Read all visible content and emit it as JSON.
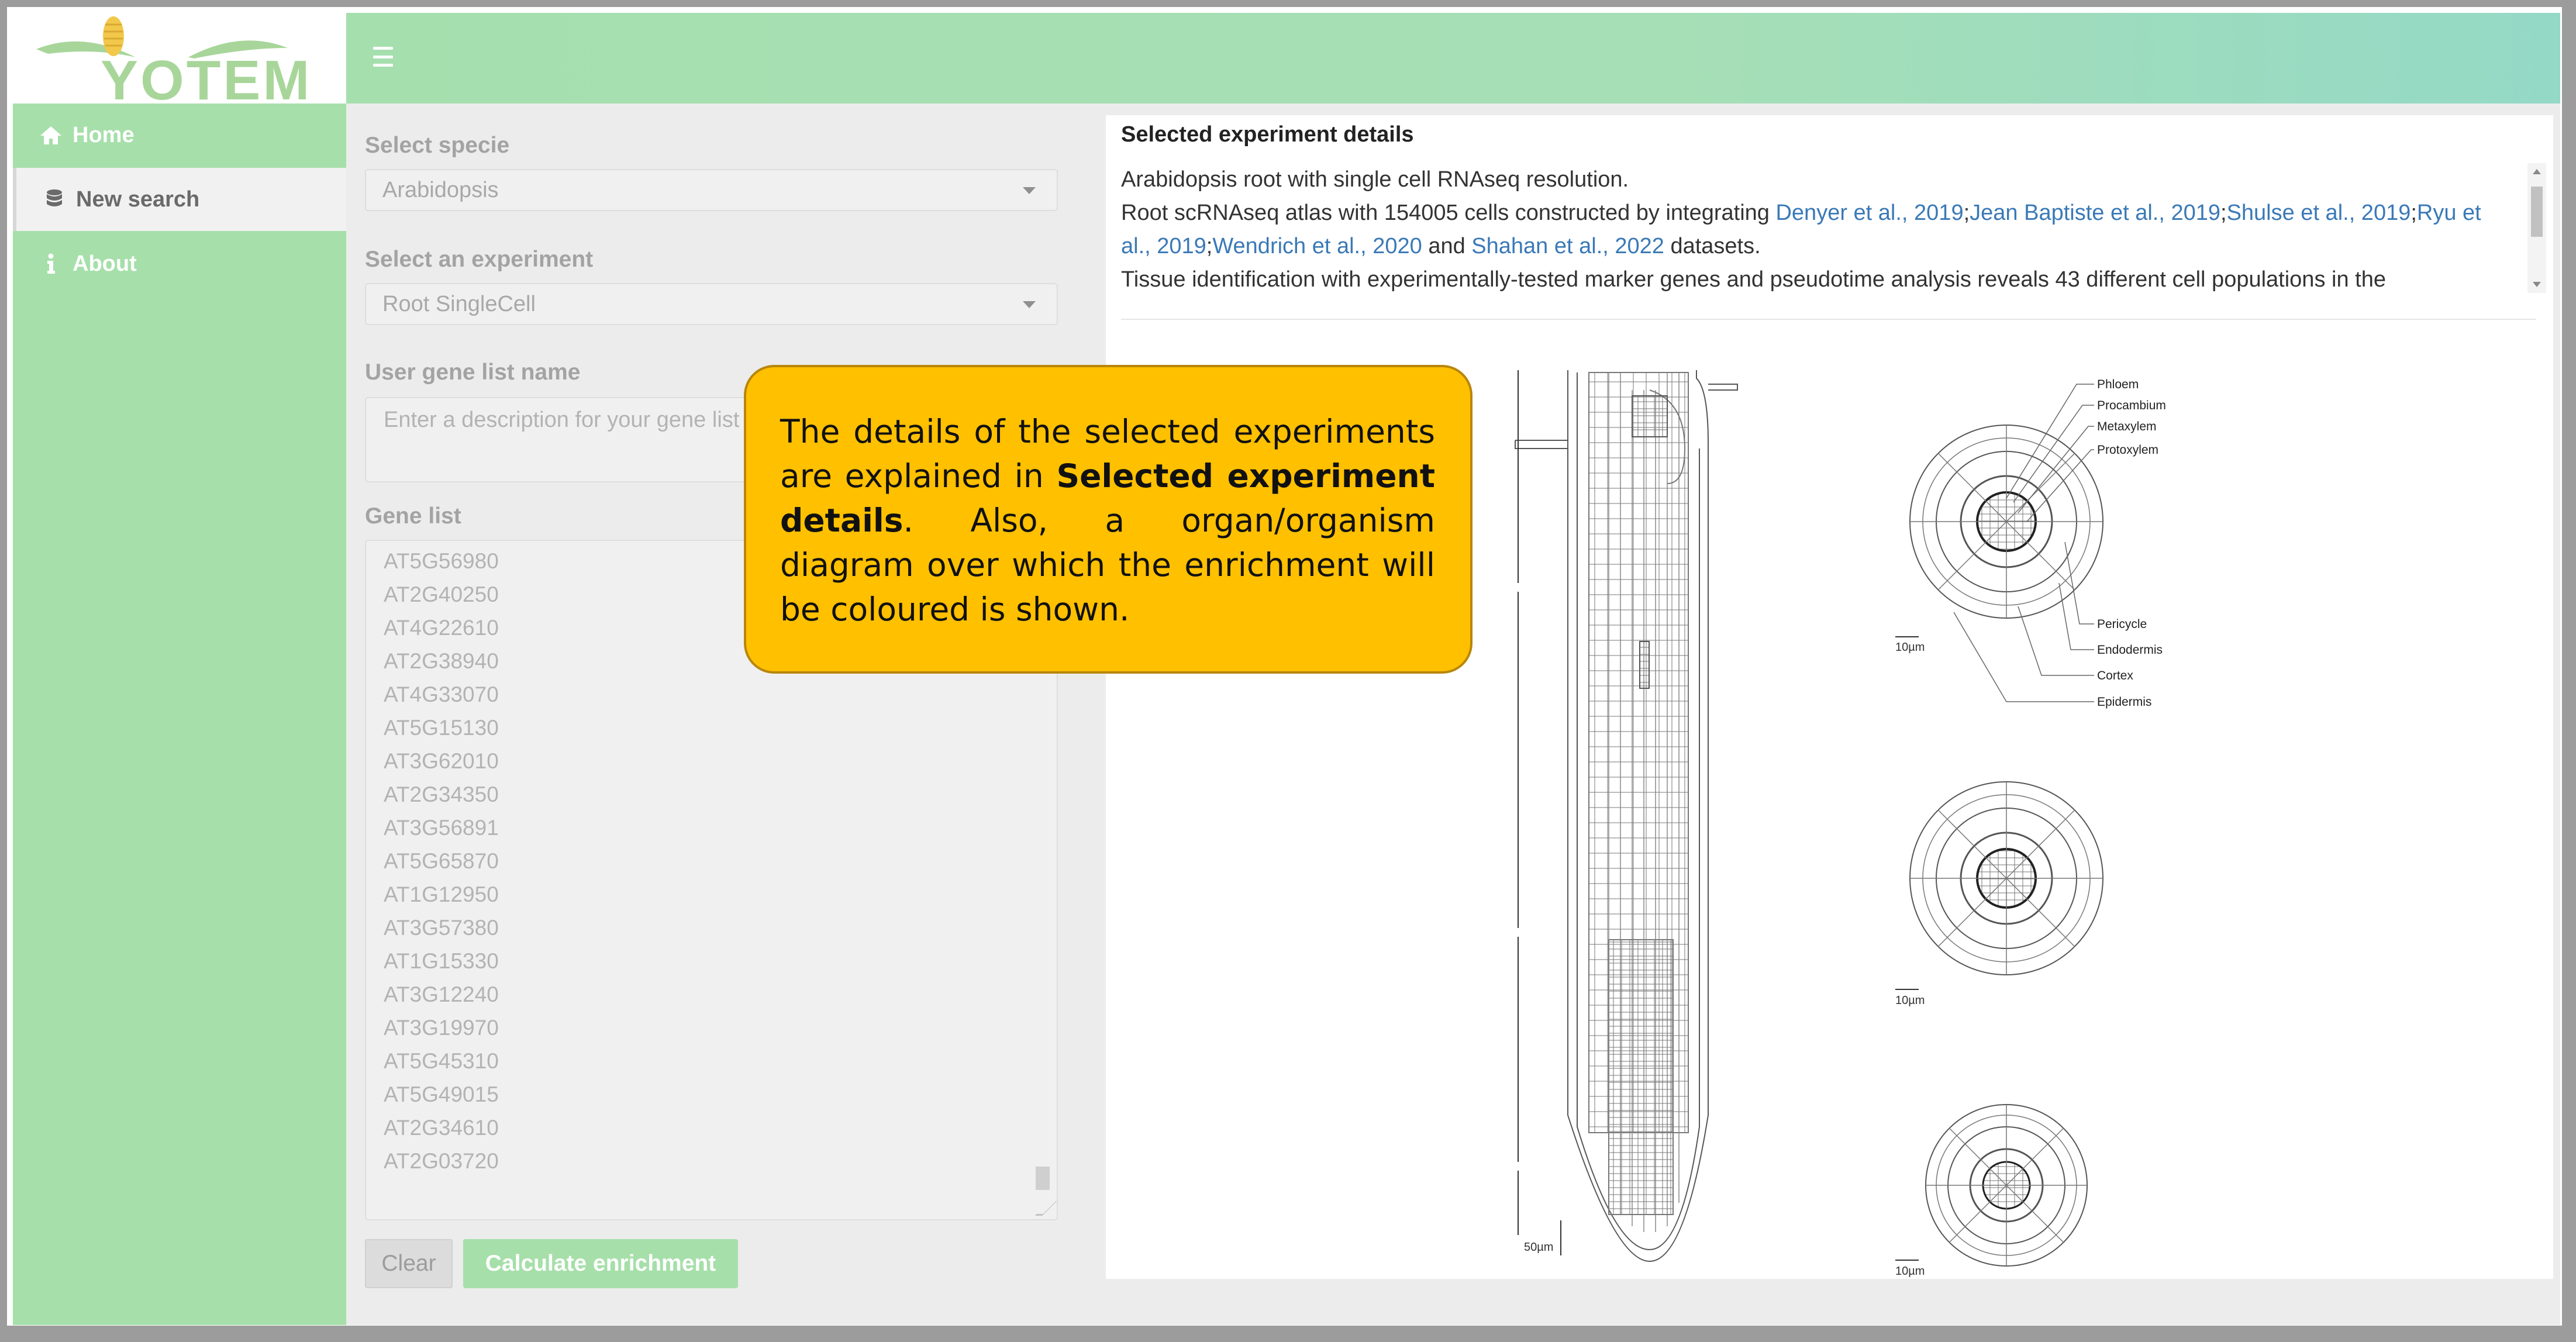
{
  "app": {
    "logo_text": "YOTEM"
  },
  "sidebar": {
    "items": [
      {
        "label": "Home",
        "icon": "home-icon"
      },
      {
        "label": "New search",
        "icon": "database-icon"
      },
      {
        "label": "About",
        "icon": "info-icon"
      }
    ],
    "active": "New search"
  },
  "form": {
    "specie": {
      "label": "Select specie",
      "value": "Arabidopsis"
    },
    "experiment": {
      "label": "Select an experiment",
      "value": "Root SingleCell"
    },
    "gene_list_name": {
      "label": "User gene list name",
      "placeholder": "Enter a description for your gene list"
    },
    "gene_list": {
      "label": "Gene list",
      "genes": [
        "AT5G56980",
        "AT2G40250",
        "AT4G22610",
        "AT2G38940",
        "AT4G33070",
        "AT5G15130",
        "AT3G62010",
        "AT2G34350",
        "AT3G56891",
        "AT5G65870",
        "AT1G12950",
        "AT3G57380",
        "AT1G15330",
        "AT3G12240",
        "AT3G19970",
        "AT5G45310",
        "AT5G49015",
        "AT2G34610",
        "AT2G03720"
      ]
    },
    "clear_label": "Clear",
    "calculate_label": "Calculate enrichment"
  },
  "details": {
    "title": "Selected experiment details",
    "line1": "Arabidopsis root with single cell RNAseq resolution.",
    "line2_prefix": "Root scRNAseq atlas with 154005 cells constructed by integrating ",
    "links": [
      "Denyer et al., 2019",
      "Jean Baptiste et al., 2019",
      "Shulse et al., 2019",
      "Ryu et al., 2019",
      "Wendrich et al., 2020",
      "Shahan et al., 2022"
    ],
    "sep": ";",
    "and_word": " and ",
    "datasets_word": " datasets.",
    "line3": "Tissue identification with experimentally-tested marker genes and pseudotime analysis reveals 43 different cell populations in the"
  },
  "diagram": {
    "labels": [
      "Phloem",
      "Procambium",
      "Metaxylem",
      "Protoxylem",
      "Pericycle",
      "Endodermis",
      "Cortex",
      "Epidermis"
    ],
    "scale_main": "50µm",
    "scale_section": "10µm"
  },
  "callout": {
    "t1": "The details of the selected experiments are explained in ",
    "b1": "Selected experiment details",
    "t2": ". Also, a organ/organism diagram over which the enrichment will be coloured is shown."
  },
  "colors": {
    "sidebar": "#a6dfaa",
    "topbar": "#a6dfb6",
    "link": "#3a79b7",
    "callout": "#ffc000"
  }
}
